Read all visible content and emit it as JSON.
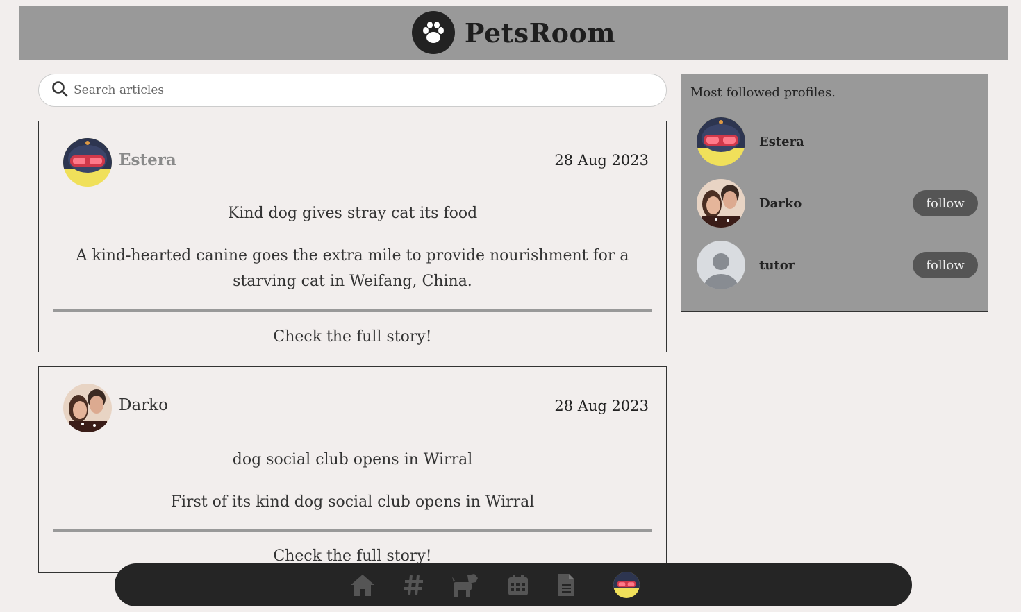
{
  "header": {
    "brand": "PetsRoom",
    "logo_icon": "paw-icon"
  },
  "search": {
    "placeholder": "Search articles"
  },
  "articles": [
    {
      "author": "Estera",
      "date": "28 Aug 2023",
      "title": "Kind dog gives stray cat its food",
      "excerpt": "A kind-hearted canine goes the extra mile to provide nourishment for a starving cat in Weifang, China.",
      "link": "Check the full story!"
    },
    {
      "author": "Darko",
      "date": "28 Aug 2023",
      "title": "dog social club opens in Wirral",
      "excerpt": "First of its kind dog social club opens in Wirral",
      "link": "Check the full story!"
    }
  ],
  "sidebar": {
    "title": "Most followed profiles.",
    "profiles": [
      {
        "name": "Estera"
      },
      {
        "name": "Darko",
        "button": "follow"
      },
      {
        "name": "tutor",
        "button": "follow"
      }
    ]
  },
  "nav": {
    "items": [
      "home-icon",
      "hashtag-icon",
      "dog-icon",
      "calendar-icon",
      "document-icon",
      "profile-avatar"
    ]
  },
  "colors": {
    "header_bg": "#999999",
    "page_bg": "#f2eeed",
    "nav_bg": "#252525",
    "button_bg": "#555555"
  }
}
